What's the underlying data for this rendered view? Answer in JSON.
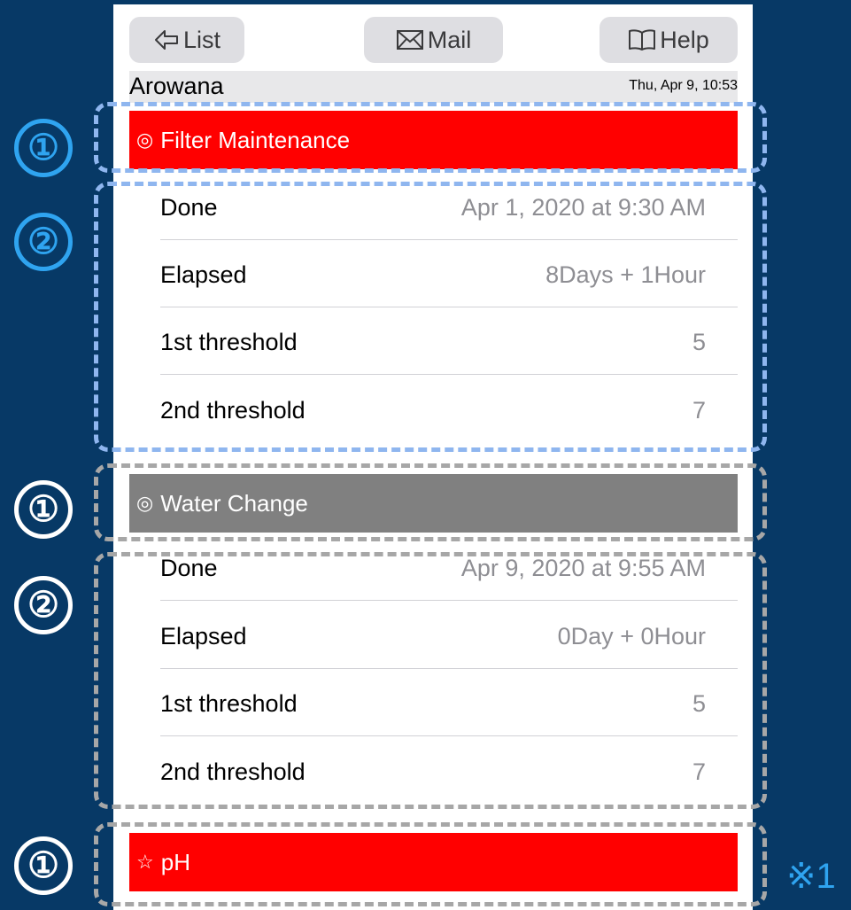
{
  "toolbar": {
    "list_label": "List",
    "mail_label": "Mail",
    "help_label": "Help"
  },
  "status": {
    "app_name": "Arowana",
    "datetime": "Thu, Apr 9, 10:53"
  },
  "sections": [
    {
      "mark": "◎",
      "title": "Filter Maintenance",
      "color": "#ff0000",
      "rows": [
        {
          "label": "Done",
          "value": "Apr 1, 2020 at 9:30 AM"
        },
        {
          "label": "Elapsed",
          "value": "8Days + 1Hour"
        },
        {
          "label": "1st threshold",
          "value": "5"
        },
        {
          "label": "2nd threshold",
          "value": "7"
        }
      ]
    },
    {
      "mark": "◎",
      "title": "Water Change",
      "color": "#808080",
      "rows": [
        {
          "label": "Done",
          "value": "Apr 9, 2020 at 9:55 AM"
        },
        {
          "label": "Elapsed",
          "value": "0Day + 0Hour"
        },
        {
          "label": "1st threshold",
          "value": "5"
        },
        {
          "label": "2nd threshold",
          "value": "7"
        }
      ]
    },
    {
      "mark": "☆",
      "title": "pH",
      "color": "#ff0000"
    }
  ],
  "annotations": {
    "one": "①",
    "two": "②",
    "note": "※1"
  }
}
